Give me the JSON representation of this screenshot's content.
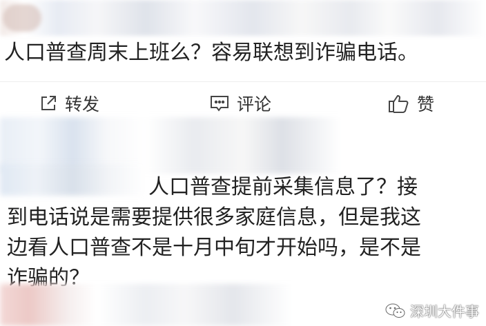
{
  "post": {
    "text": "人口普查周末上班么？容易联想到诈骗电话。"
  },
  "actions": {
    "repost_label": "转发",
    "comment_label": "评论",
    "like_label": "赞"
  },
  "reply": {
    "lines": [
      "人口普查提前采集信息了？接",
      "到电话说是需要提供很多家庭信息，但是我这",
      "边看人口普查不是十月中旬才开始吗，是不是",
      "诈骗的？"
    ]
  },
  "watermark": {
    "text": "深圳大件事"
  },
  "icons": [
    "repost-icon",
    "comment-icon",
    "thumbs-up-icon",
    "wechat-icon"
  ]
}
